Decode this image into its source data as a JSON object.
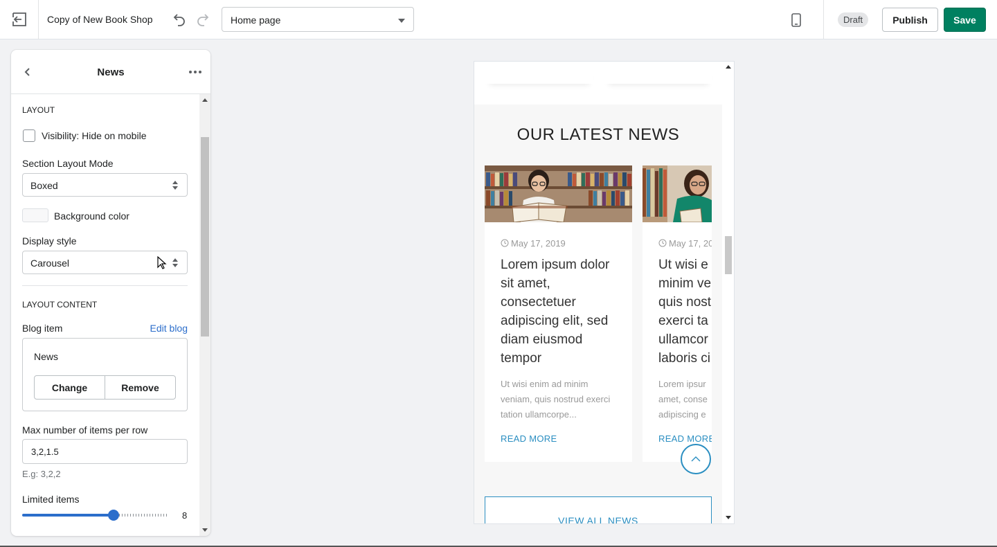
{
  "topbar": {
    "shop_name": "Copy of New Book Shop",
    "page_select": "Home page",
    "status_badge": "Draft",
    "publish_label": "Publish",
    "save_label": "Save"
  },
  "panel": {
    "title": "News",
    "layout_heading": "LAYOUT",
    "visibility_label": "Visibility: Hide on mobile",
    "visibility_checked": false,
    "section_layout_label": "Section Layout Mode",
    "section_layout_value": "Boxed",
    "bg_color_label": "Background color",
    "display_style_label": "Display style",
    "display_style_value": "Carousel",
    "content_heading": "LAYOUT CONTENT",
    "blog_item_label": "Blog item",
    "edit_blog_link": "Edit blog",
    "blog_name": "News",
    "change_label": "Change",
    "remove_label": "Remove",
    "max_items_label": "Max number of items per row",
    "max_items_value": "3,2,1.5",
    "max_items_hint": "E.g: 3,2,2",
    "limited_items_label": "Limited items",
    "limited_items_value": "8"
  },
  "preview": {
    "section_title": "OUR LATEST NEWS",
    "cards": [
      {
        "date": "May 17, 2019",
        "title": "Lorem ipsum dolor sit amet, consectetuer adipiscing elit, sed diam eiusmod tempor",
        "excerpt": "Ut wisi enim ad minim veniam, quis nostrud exerci tation ullamcorpe...",
        "read_more": "READ MORE"
      },
      {
        "date": "May 17, 20",
        "title": "Ut wisi e minim ve quis nost exerci ta ullamcor laboris ci",
        "excerpt": "Lorem ipsur amet, conse adipiscing e",
        "read_more": "READ MORE"
      }
    ],
    "view_all": "VIEW ALL NEWS"
  },
  "colors": {
    "primary_green": "#008060",
    "accent_blue": "#2a8ec1",
    "slider_blue": "#2c6ecb"
  }
}
